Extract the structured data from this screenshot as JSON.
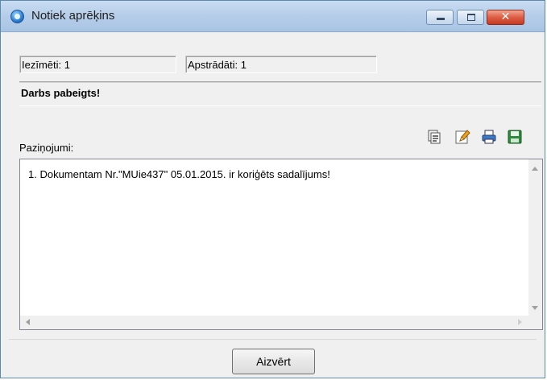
{
  "window": {
    "title": "Notiek aprēķins",
    "close_glyph": "✕"
  },
  "stats": {
    "marked": "Iezīmēti: 1",
    "processed": "Apstrādāti: 1"
  },
  "status": "Darbs pabeigts!",
  "notifications": {
    "label": "Paziņojumi:",
    "lines": [
      "1. Dokumentam Nr.\"MUie437\" 05.01.2015. ir koriģēts sadalījums!"
    ]
  },
  "toolbar_icons": [
    "list-icon",
    "edit-icon",
    "print-icon",
    "save-icon"
  ],
  "footer": {
    "close_label": "Aizvērt"
  },
  "colors": {
    "titlebar": "#b5cde9",
    "close_button": "#dd5e45"
  }
}
